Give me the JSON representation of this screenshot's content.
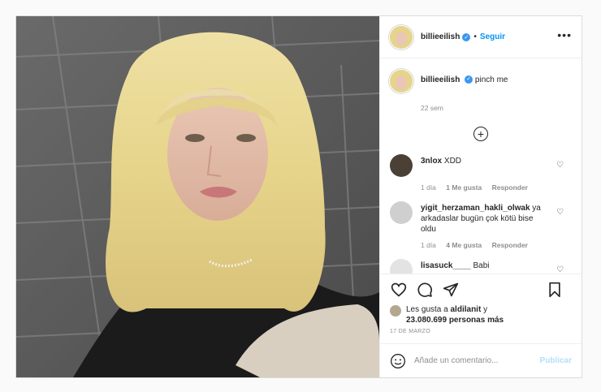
{
  "header": {
    "username": "billieeilish",
    "separator": "•",
    "follow_label": "Seguir",
    "more_label": "•••"
  },
  "caption": {
    "username": "billieeilish",
    "text": "pinch me",
    "age": "22 sem"
  },
  "comments": [
    {
      "username": "3nlox",
      "text": "XDD",
      "time": "1 día",
      "likes": "1 Me gusta",
      "reply": "Responder"
    },
    {
      "username": "yigit_herzaman_hakli_olwak",
      "text": "ya arkadaslar bugün çok kötü bise oldu",
      "time": "1 día",
      "likes": "4 Me gusta",
      "reply": "Responder"
    },
    {
      "username": "lisasuck____",
      "text": "Babi"
    }
  ],
  "likes": {
    "prefix": "Les gusta a",
    "user": "aldilanit",
    "connector": "y",
    "count": "23.080.699 personas más"
  },
  "date": "17 DE MARZO",
  "composer": {
    "placeholder": "Añade un comentario...",
    "publish_label": "Publicar"
  },
  "icons": {
    "verified": "verified-badge-icon",
    "more": "more-options-icon",
    "load_more": "plus-circle-icon",
    "like": "heart-icon",
    "comment": "comment-bubble-icon",
    "share": "paper-plane-icon",
    "save": "bookmark-icon",
    "emoji": "emoji-icon"
  },
  "colors": {
    "accent": "#0095f6",
    "verified": "#3897f0",
    "publish_disabled": "#b2dffc",
    "muted": "#8e8e8e"
  }
}
